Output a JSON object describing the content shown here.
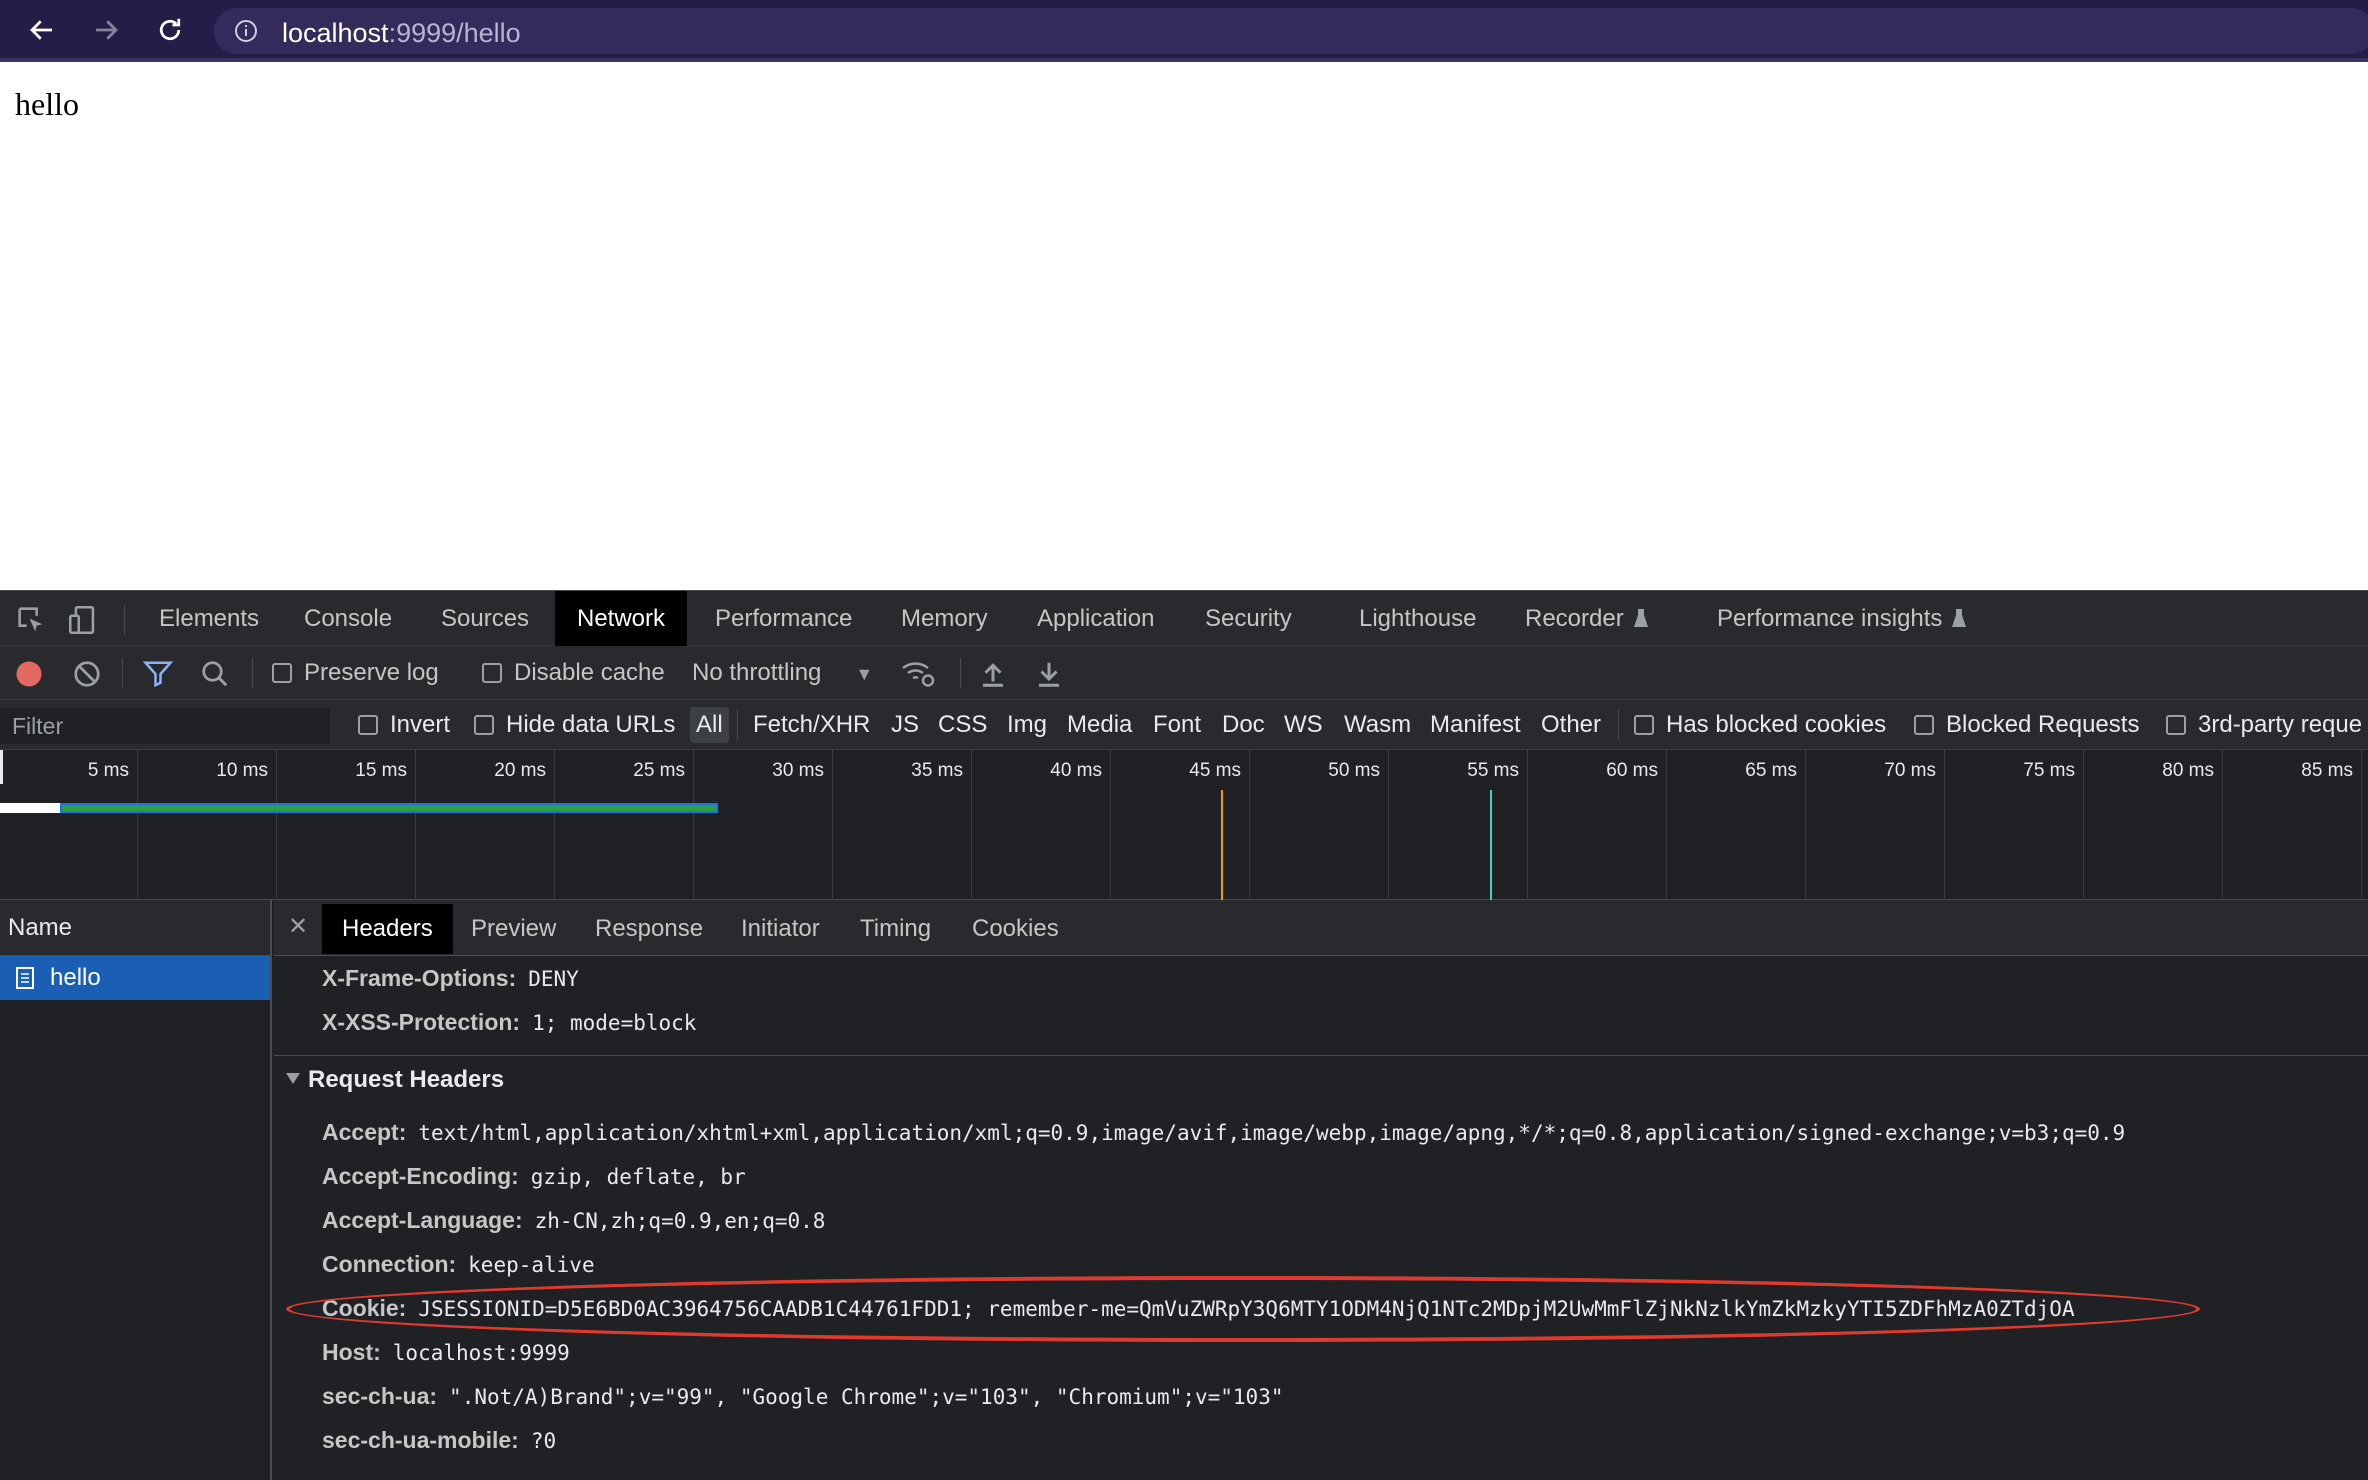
{
  "browser": {
    "url_host": "localhost",
    "url_path": ":9999/hello"
  },
  "page": {
    "text": "hello"
  },
  "devtools": {
    "tabs": [
      "Elements",
      "Console",
      "Sources",
      "Network",
      "Performance",
      "Memory",
      "Application",
      "Security",
      "Lighthouse",
      "Recorder",
      "Performance insights"
    ],
    "active_tab": "Network",
    "toolbar": {
      "preserve_log": "Preserve log",
      "disable_cache": "Disable cache",
      "throttling": "No throttling"
    },
    "filter": {
      "placeholder": "Filter",
      "invert": "Invert",
      "hide_data_urls": "Hide data URLs",
      "types": [
        "All",
        "Fetch/XHR",
        "JS",
        "CSS",
        "Img",
        "Media",
        "Font",
        "Doc",
        "WS",
        "Wasm",
        "Manifest",
        "Other"
      ],
      "has_blocked_cookies": "Has blocked cookies",
      "blocked_requests": "Blocked Requests",
      "third_party": "3rd-party reque"
    },
    "timeline": {
      "ticks": [
        "5 ms",
        "10 ms",
        "15 ms",
        "20 ms",
        "25 ms",
        "30 ms",
        "35 ms",
        "40 ms",
        "45 ms",
        "50 ms",
        "55 ms",
        "60 ms",
        "65 ms",
        "70 ms",
        "75 ms",
        "80 ms",
        "85 ms"
      ]
    },
    "requests": {
      "column_name": "Name",
      "items": [
        "hello"
      ]
    },
    "detail_tabs": [
      "Headers",
      "Preview",
      "Response",
      "Initiator",
      "Timing",
      "Cookies"
    ],
    "active_detail_tab": "Headers",
    "response_headers": [
      {
        "name": "X-Frame-Options:",
        "value": "DENY"
      },
      {
        "name": "X-XSS-Protection:",
        "value": "1; mode=block"
      }
    ],
    "request_headers_title": "Request Headers",
    "request_headers": [
      {
        "name": "Accept:",
        "value": "text/html,application/xhtml+xml,application/xml;q=0.9,image/avif,image/webp,image/apng,*/*;q=0.8,application/signed-exchange;v=b3;q=0.9"
      },
      {
        "name": "Accept-Encoding:",
        "value": "gzip, deflate, br"
      },
      {
        "name": "Accept-Language:",
        "value": "zh-CN,zh;q=0.9,en;q=0.8"
      },
      {
        "name": "Connection:",
        "value": "keep-alive"
      },
      {
        "name": "Cookie:",
        "value": "JSESSIONID=D5E6BD0AC3964756CAADB1C44761FDD1; remember-me=QmVuZWRpY3Q6MTY1ODM4NjQ1NTc2MDpjM2UwMmFlZjNkNzlkYmZkMzkyYTI5ZDFhMzA0ZTdjOA"
      },
      {
        "name": "Host:",
        "value": "localhost:9999"
      },
      {
        "name": "sec-ch-ua:",
        "value": "\".Not/A)Brand\";v=\"99\", \"Google Chrome\";v=\"103\", \"Chromium\";v=\"103\""
      },
      {
        "name": "sec-ch-ua-mobile:",
        "value": "?0"
      }
    ],
    "colors": {
      "record": "#e46962",
      "filter_icon": "#8ab4f8",
      "highlight": "#e03a2e",
      "selected_row": "#1a5fb4"
    }
  }
}
